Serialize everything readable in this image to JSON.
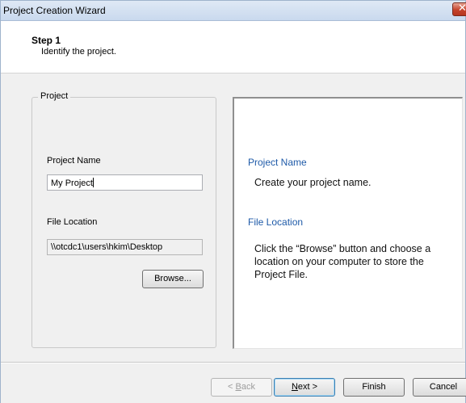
{
  "window": {
    "title": "Project Creation Wizard",
    "close_glyph": "✕"
  },
  "header": {
    "step_title": "Step 1",
    "step_subtitle": "Identify the project."
  },
  "project_group": {
    "label": "Project",
    "project_name_label": "Project Name",
    "project_name_value": "My Project",
    "file_location_label": "File Location",
    "file_location_value": "\\\\otcdc1\\users\\hkim\\Desktop",
    "browse_label": "Browse..."
  },
  "help": {
    "project_name_heading": "Project Name",
    "project_name_text": "Create your project name.",
    "file_location_heading": "File Location",
    "file_location_text": "Click the “Browse” button and choose a location on your computer to store the Project File."
  },
  "footer": {
    "back_prefix": "< ",
    "back_mnemonic": "B",
    "back_rest": "ack",
    "next_mnemonic": "N",
    "next_rest": "ext >",
    "finish_label": "Finish",
    "cancel_label": "Cancel"
  },
  "icons": {
    "close": "close-icon"
  }
}
